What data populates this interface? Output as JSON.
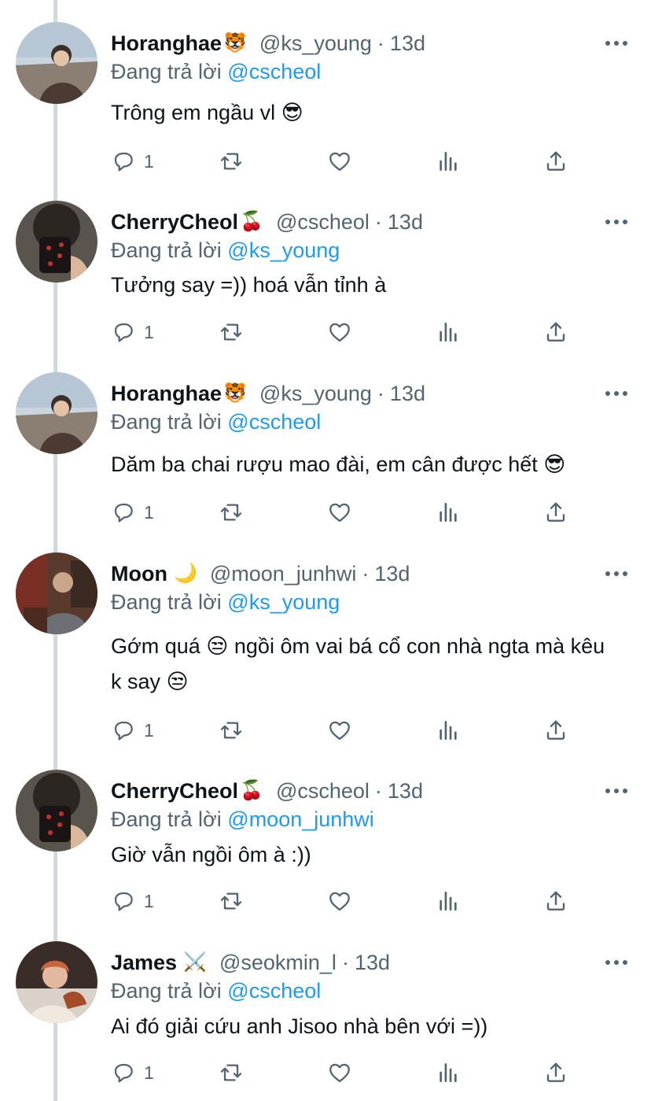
{
  "colors": {
    "accent": "#1d9bf0",
    "muted": "#536471",
    "thread_line": "#cfd9de"
  },
  "icons": {
    "reply": "reply-bubble-icon",
    "retweet": "retweet-icon",
    "like": "heart-icon",
    "stats": "bar-chart-icon",
    "share": "share-icon",
    "more": "more-dots-icon"
  },
  "tweets": [
    {
      "name": "Horanghae",
      "name_emoji": "🐯",
      "handle": "@ks_young",
      "sep": "·",
      "time": "13d",
      "reply_prefix": "Đang trả lời",
      "reply_to": "@cscheol",
      "text": "Trông em ngầu vl 😎",
      "reply_count": "1"
    },
    {
      "name": "CherryCheol",
      "name_emoji": "🍒",
      "handle": "@cscheol",
      "sep": "·",
      "time": "13d",
      "reply_prefix": "Đang trả lời",
      "reply_to": "@ks_young",
      "text": "Tưởng say =)) hoá vẫn tỉnh à",
      "reply_count": "1"
    },
    {
      "name": "Horanghae",
      "name_emoji": "🐯",
      "handle": "@ks_young",
      "sep": "·",
      "time": "13d",
      "reply_prefix": "Đang trả lời",
      "reply_to": "@cscheol",
      "text": "Dăm ba chai rượu mao đài, em cân được hết 😎",
      "reply_count": "1"
    },
    {
      "name": "Moon",
      "name_emoji": "🌙",
      "handle": "@moon_junhwi",
      "sep": "·",
      "time": "13d",
      "reply_prefix": "Đang trả lời",
      "reply_to": "@ks_young",
      "text": "Gớm quá 😒  ngồi ôm vai bá cổ con nhà ngta mà kêu k say 😒",
      "reply_count": "1"
    },
    {
      "name": "CherryCheol",
      "name_emoji": "🍒",
      "handle": "@cscheol",
      "sep": "·",
      "time": "13d",
      "reply_prefix": "Đang trả lời",
      "reply_to": "@moon_junhwi",
      "text": "Giờ vẫn ngồi ôm à :))",
      "reply_count": "1"
    },
    {
      "name": "James",
      "name_emoji": "⚔️",
      "handle": "@seokmin_l",
      "sep": "·",
      "time": "13d",
      "reply_prefix": "Đang trả lời",
      "reply_to": "@cscheol",
      "text": "Ai đó giải cứu anh Jisoo nhà bên với =))",
      "reply_count": "1"
    }
  ]
}
